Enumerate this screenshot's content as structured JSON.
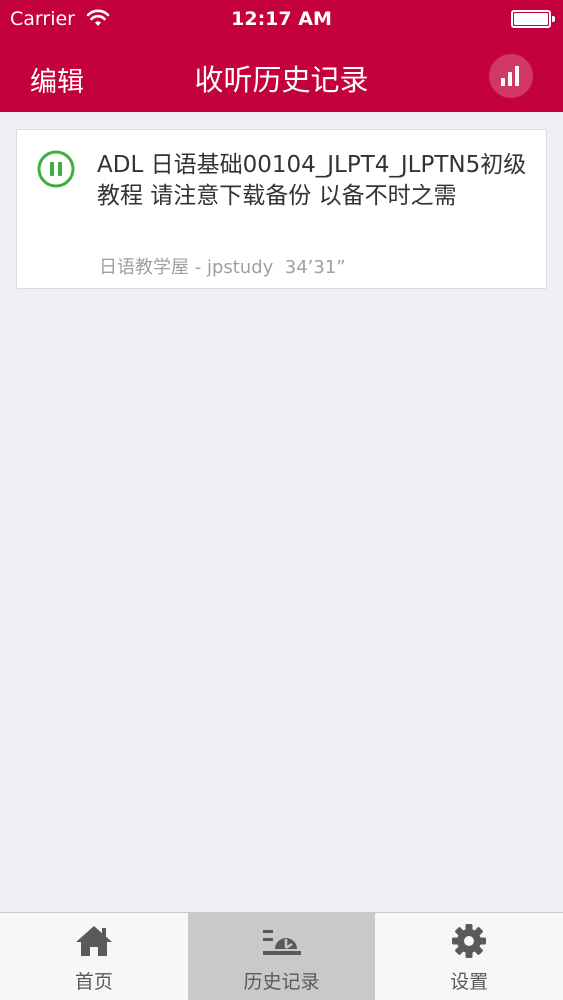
{
  "status_bar": {
    "carrier": "Carrier",
    "time": "12:17 AM",
    "wifi_icon": "wifi-icon",
    "battery_icon": "battery-icon"
  },
  "nav": {
    "edit_label": "编辑",
    "title": "收听历史记录",
    "stats_icon": "bar-chart-icon"
  },
  "history": [
    {
      "title": "ADL 日语基础00104_JLPT4_JLPTN5初级教程 请注意下载备份 以备不时之需",
      "source": "日语教学屋 - jpstudy",
      "duration": "34’31”",
      "state_icon": "pause-icon"
    }
  ],
  "tabs": [
    {
      "label": "首页",
      "icon": "home-icon",
      "active": false
    },
    {
      "label": "历史记录",
      "icon": "history-icon",
      "active": true
    },
    {
      "label": "设置",
      "icon": "gear-icon",
      "active": false
    }
  ],
  "colors": {
    "brand": "#c5003e",
    "background": "#efeff4",
    "pause_green": "#3fae3a",
    "tab_active": "#c9c9cc"
  }
}
